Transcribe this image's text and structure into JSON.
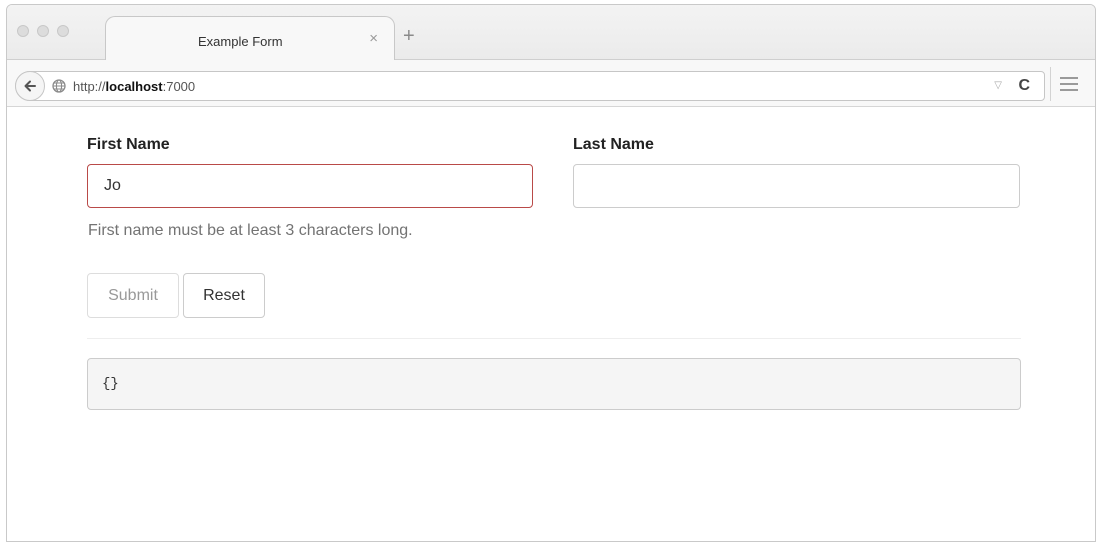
{
  "browser": {
    "tab": {
      "title": "Example Form",
      "close_glyph": "×"
    },
    "new_tab_glyph": "+",
    "url": {
      "scheme": "http://",
      "host": "localhost",
      "port": ":7000"
    },
    "icons": {
      "back": "back-arrow-icon",
      "site": "globe-icon",
      "dropdown": "dropdown-triangle-icon",
      "reload": "reload-icon",
      "menu": "hamburger-menu-icon"
    },
    "reload_glyph": "C",
    "dropdown_glyph": "▽"
  },
  "form": {
    "first_name": {
      "label": "First Name",
      "value": "Jo",
      "error": "First name must be at least 3 characters long.",
      "error_border_color": "#b94a48"
    },
    "last_name": {
      "label": "Last Name",
      "value": ""
    },
    "buttons": {
      "submit": "Submit",
      "reset": "Reset"
    },
    "output": "{}"
  }
}
